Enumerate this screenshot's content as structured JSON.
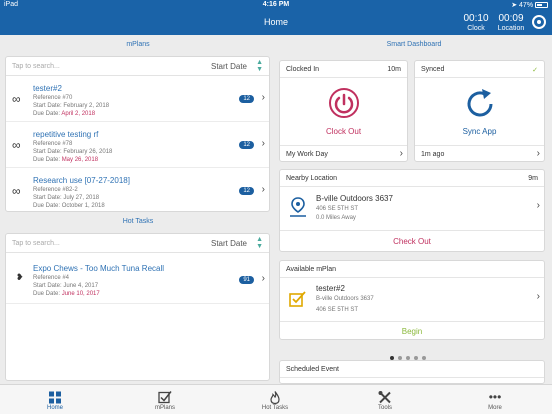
{
  "status_bar": {
    "carrier": "iPad",
    "time": "4:16 PM",
    "battery": "47%",
    "battery_level": 0.47
  },
  "nav": {
    "title": "Home",
    "clock": {
      "value": "00:10",
      "label": "Clock"
    },
    "location": {
      "value": "00:09",
      "label": "Location"
    }
  },
  "mplans": {
    "heading": "mPlans",
    "search_placeholder": "Tap to search...",
    "sort_label": "Start Date",
    "items": [
      {
        "title": "tester#2",
        "reference": "Reference #70",
        "start": "Start Date: February 2, 2018",
        "due_label": "Due Date:",
        "due": "April 2, 2018",
        "badge": "12"
      },
      {
        "title": "repetitive testing rf",
        "reference": "Reference #78",
        "start": "Start Date: February 26, 2018",
        "due_label": "Due Date:",
        "due": "May 26, 2018",
        "badge": "12"
      },
      {
        "title": "Research use [07-27-2018]",
        "reference": "Reference #82-2",
        "start": "Start Date: July 27, 2018",
        "due_label": "Due Date:",
        "due": "October 1, 2018",
        "badge": "12"
      }
    ]
  },
  "hot_tasks": {
    "heading": "Hot Tasks",
    "search_placeholder": "Tap to search...",
    "sort_label": "Start Date",
    "items": [
      {
        "title": "Expo Chews - Too Much Tuna Recall",
        "reference": "Reference #4",
        "start": "Start Date: June 4, 2017",
        "due_label": "Due Date:",
        "due": "June 10, 2017",
        "badge": "91"
      }
    ]
  },
  "dashboard": {
    "heading": "Smart Dashboard",
    "clocked_in": {
      "label": "Clocked In",
      "duration": "10m",
      "action": "Clock Out",
      "footer": "My Work Day"
    },
    "synced": {
      "label": "Synced",
      "action": "Sync App",
      "footer": "1m ago"
    },
    "nearby": {
      "label": "Nearby Location",
      "duration": "9m",
      "name": "B-ville Outdoors 3637",
      "address": "406 SE 5TH ST",
      "distance": "0.0 Miles Away",
      "action": "Check Out"
    },
    "available": {
      "label": "Available mPlan",
      "title": "tester#2",
      "location": "B-ville Outdoors 3637",
      "address": "406 SE 5TH ST",
      "action": "Begin"
    },
    "scheduled": {
      "label": "Scheduled Event"
    }
  },
  "tabs": [
    {
      "label": "Home",
      "icon": "home-grid-icon",
      "active": true
    },
    {
      "label": "mPlans",
      "icon": "checkbox-icon",
      "active": false
    },
    {
      "label": "Hot Tasks",
      "icon": "flame-icon",
      "active": false
    },
    {
      "label": "Tools",
      "icon": "tools-icon",
      "active": false
    },
    {
      "label": "More",
      "icon": "more-dots-icon",
      "active": false
    }
  ],
  "colors": {
    "primary": "#1a63a8",
    "accent_red": "#c0305f",
    "accent_green": "#8ab83a",
    "teal": "#4aaa9d"
  }
}
